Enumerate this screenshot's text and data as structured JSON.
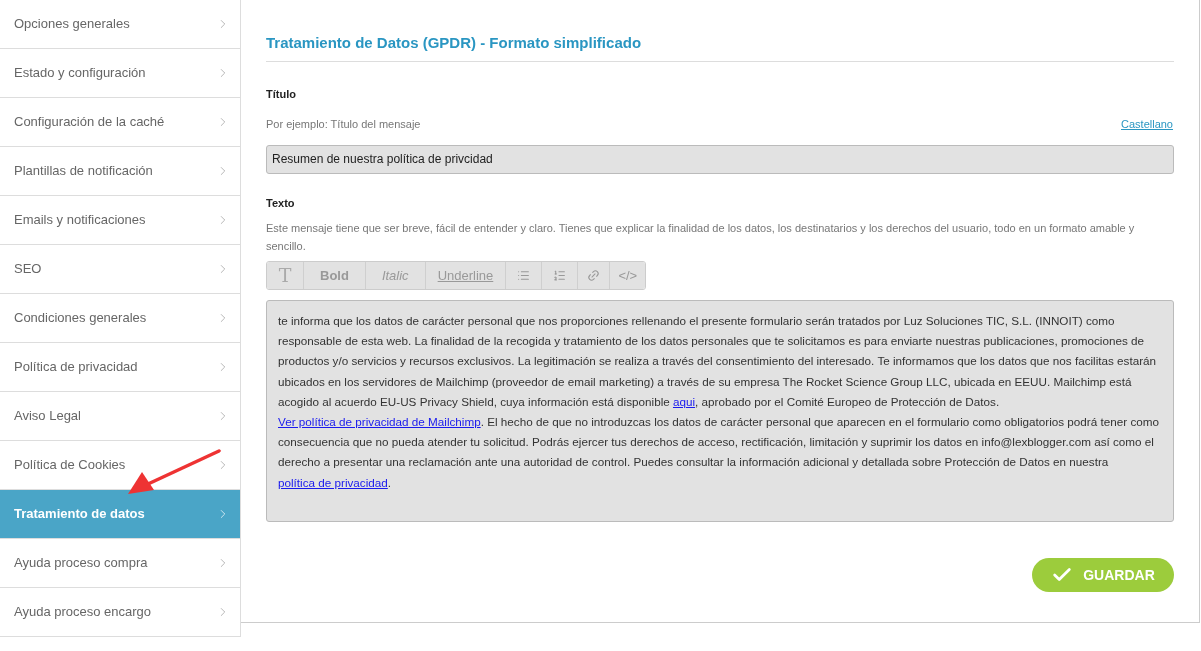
{
  "sidebar": {
    "items": [
      {
        "label": "Opciones generales",
        "selected": false
      },
      {
        "label": "Estado y configuración",
        "selected": false
      },
      {
        "label": "Configuración de la caché",
        "selected": false
      },
      {
        "label": "Plantillas de notificación",
        "selected": false
      },
      {
        "label": "Emails y notificaciones",
        "selected": false
      },
      {
        "label": "SEO",
        "selected": false
      },
      {
        "label": "Condiciones generales",
        "selected": false
      },
      {
        "label": "Política de privacidad",
        "selected": false
      },
      {
        "label": "Aviso Legal",
        "selected": false
      },
      {
        "label": "Política de Cookies",
        "selected": false
      },
      {
        "label": "Tratamiento de datos",
        "selected": true
      },
      {
        "label": "Ayuda proceso compra",
        "selected": false
      },
      {
        "label": "Ayuda proceso encargo",
        "selected": false
      }
    ]
  },
  "main": {
    "heading": "Tratamiento de Datos (GPDR) - Formato simplificado",
    "title_field": {
      "label": "Título",
      "hint": "Por ejemplo: Título del mensaje",
      "language_link": "Castellano",
      "value": "Resumen de nuestra política de privcidad"
    },
    "text_field": {
      "label": "Texto",
      "hint": "Este mensaje tiene que ser breve, fácil de entender y claro. Tienes que explicar la finalidad de los datos, los destinatarios y los derechos del usuario, todo en un formato amable y sencillo.",
      "toolbar": [
        {
          "kind": "format-icon",
          "label": "T"
        },
        {
          "kind": "bold",
          "label": "Bold"
        },
        {
          "kind": "italic",
          "label": "Italic"
        },
        {
          "kind": "underline",
          "label": "Underline"
        },
        {
          "kind": "bullet-list"
        },
        {
          "kind": "numbered-list"
        },
        {
          "kind": "link"
        },
        {
          "kind": "code",
          "label": "</>"
        }
      ],
      "body": [
        {
          "kind": "text",
          "text": "te informa que los datos de carácter personal que nos proporciones rellenando el presente formulario serán tratados por Luz Soluciones TIC, S.L. (INNOIT) como responsable de esta web. La finalidad de la recogida y tratamiento de los datos personales que te solicitamos es para enviarte nuestras publicaciones, promociones de productos y/o servicios y recursos exclusivos. La legitimación se realiza a través del consentimiento del interesado. Te informamos que los datos que nos facilitas estarán ubicados en los servidores de Mailchimp (proveedor de email marketing) a través de su empresa The Rocket Science Group LLC, ubicada en EEUU. Mailchimp está acogido al acuerdo EU-US Privacy Shield, cuya información está disponible "
        },
        {
          "kind": "link",
          "text": "aqui"
        },
        {
          "kind": "text",
          "text": ", aprobado por el Comité Europeo de Protección de Datos. "
        },
        {
          "kind": "link",
          "text": "Ver política de privacidad de Mailchimp"
        },
        {
          "kind": "text",
          "text": ". El hecho de que no introduzcas los datos de carácter personal que aparecen en el formulario como obligatorios podrá tener como consecuencia que no pueda atender tu solicitud. Podrás ejercer tus derechos de acceso, rectificación, limitación y suprimir los datos en info@lexblogger.com así como el derecho a presentar una reclamación ante una autoridad de control. Puedes consultar la información adicional y detallada sobre Protección de Datos en  nuestra "
        },
        {
          "kind": "link",
          "text": "política de privacidad"
        },
        {
          "kind": "text",
          "text": "."
        }
      ]
    },
    "save_button": "GUARDAR"
  }
}
